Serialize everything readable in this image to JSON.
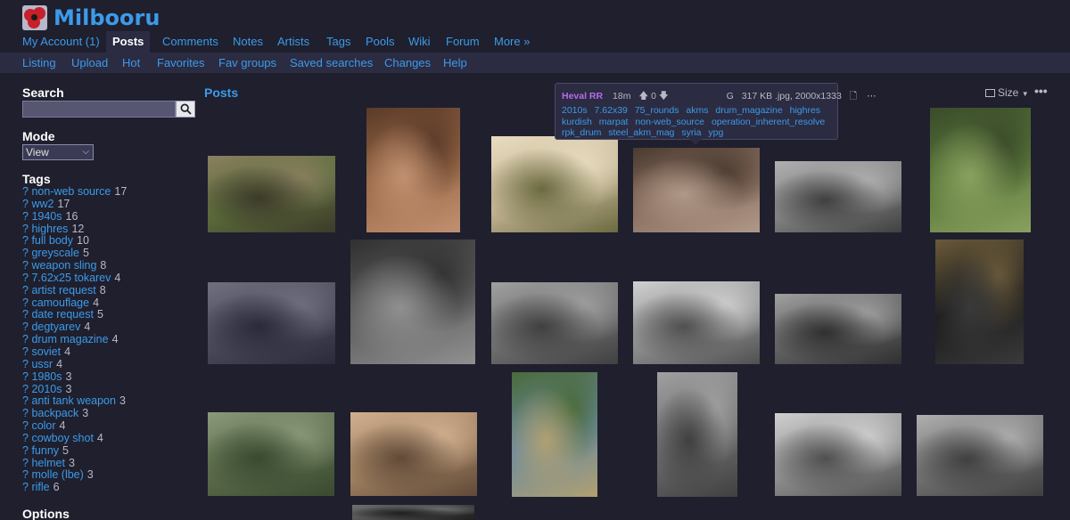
{
  "site": {
    "title": "Milbooru"
  },
  "nav": {
    "main": [
      "My Account (1)",
      "Posts",
      "Comments",
      "Notes",
      "Artists",
      "Tags",
      "Pools",
      "Wiki",
      "Forum",
      "More »"
    ],
    "sub": [
      "Listing",
      "Upload",
      "Hot",
      "Favorites",
      "Fav groups",
      "Saved searches",
      "Changes",
      "Help"
    ]
  },
  "sidebar": {
    "search_heading": "Search",
    "search_value": "",
    "mode_heading": "Mode",
    "mode_value": "View",
    "tags_heading": "Tags",
    "tags": [
      {
        "name": "non-web source",
        "count": "17"
      },
      {
        "name": "ww2",
        "count": "17"
      },
      {
        "name": "1940s",
        "count": "16"
      },
      {
        "name": "highres",
        "count": "12"
      },
      {
        "name": "full body",
        "count": "10"
      },
      {
        "name": "greyscale",
        "count": "5"
      },
      {
        "name": "weapon sling",
        "count": "8"
      },
      {
        "name": "7.62x25 tokarev",
        "count": "4"
      },
      {
        "name": "artist request",
        "count": "8"
      },
      {
        "name": "camouflage",
        "count": "4"
      },
      {
        "name": "date request",
        "count": "5"
      },
      {
        "name": "degtyarev",
        "count": "4"
      },
      {
        "name": "drum magazine",
        "count": "4"
      },
      {
        "name": "soviet",
        "count": "4"
      },
      {
        "name": "ussr",
        "count": "4"
      },
      {
        "name": "1980s",
        "count": "3"
      },
      {
        "name": "2010s",
        "count": "3"
      },
      {
        "name": "anti tank weapon",
        "count": "3"
      },
      {
        "name": "backpack",
        "count": "3"
      },
      {
        "name": "color",
        "count": "4"
      },
      {
        "name": "cowboy shot",
        "count": "4"
      },
      {
        "name": "funny",
        "count": "5"
      },
      {
        "name": "helmet",
        "count": "3"
      },
      {
        "name": "molle (lbe)",
        "count": "3"
      },
      {
        "name": "rifle",
        "count": "6"
      }
    ],
    "options_heading": "Options"
  },
  "posts": {
    "title": "Posts",
    "size_label": "Size",
    "more_label": "•••"
  },
  "tooltip": {
    "user": "Heval RR",
    "age": "18m",
    "score": "0",
    "rating": "G",
    "file_info": "317 KB .jpg, 2000x1333",
    "tags": [
      "2010s",
      "7.62x39",
      "75_rounds",
      "akms",
      "drum_magazine",
      "highres",
      "kurdish",
      "marpat",
      "non-web_source",
      "operation_inherent_resolve",
      "rpk_drum",
      "steel_akm_mag",
      "syria",
      "ypg"
    ]
  },
  "thumbnails": [
    {
      "name": "thumb-afghan-fighters",
      "colors": [
        "#5a6b3a",
        "#3d3a2a",
        "#8a8060"
      ]
    },
    {
      "name": "thumb-soldier-rpg",
      "colors": [
        "#9a6a48",
        "#c09070",
        "#5a3a28"
      ]
    },
    {
      "name": "thumb-soldier-firing-rpg",
      "colors": [
        "#c8b898",
        "#6a6a40",
        "#e8dcc0"
      ]
    },
    {
      "name": "thumb-kurdish-fighter",
      "colors": [
        "#8a7060",
        "#b09888",
        "#4a3a30"
      ]
    },
    {
      "name": "thumb-trench-soldiers",
      "colors": [
        "#808080",
        "#404040",
        "#b0b0b0"
      ]
    },
    {
      "name": "thumb-officers-park",
      "colors": [
        "#5a7a3a",
        "#8aa060",
        "#3a4a2a"
      ]
    },
    {
      "name": "thumb-spec-ops-team",
      "colors": [
        "#4a4a5a",
        "#2a2a3a",
        "#707080"
      ]
    },
    {
      "name": "thumb-german-soldiers",
      "colors": [
        "#606060",
        "#909090",
        "#303030"
      ]
    },
    {
      "name": "thumb-factory-woman",
      "colors": [
        "#707070",
        "#404040",
        "#a0a0a0"
      ]
    },
    {
      "name": "thumb-red-flag-soldiers",
      "colors": [
        "#909090",
        "#505050",
        "#d0d0d0"
      ]
    },
    {
      "name": "thumb-firing-line",
      "colors": [
        "#606060",
        "#303030",
        "#a0a0a0"
      ]
    },
    {
      "name": "thumb-poster-document",
      "colors": [
        "#1a1a1a",
        "#3a3a3a",
        "#6a5a3a"
      ]
    },
    {
      "name": "thumb-soldier-helmet",
      "colors": [
        "#5a6a4a",
        "#3a4a30",
        "#8a9a7a"
      ]
    },
    {
      "name": "thumb-desert-soldier",
      "colors": [
        "#a08060",
        "#604a38",
        "#d0b090"
      ]
    },
    {
      "name": "thumb-beach-carry",
      "colors": [
        "#6a8aa0",
        "#b0a070",
        "#4a6a3a"
      ]
    },
    {
      "name": "thumb-artillery-gun",
      "colors": [
        "#707070",
        "#404040",
        "#a0a0a0"
      ]
    },
    {
      "name": "thumb-children-cannon",
      "colors": [
        "#909090",
        "#505050",
        "#d0d0d0"
      ]
    },
    {
      "name": "thumb-soldier-bazooka",
      "colors": [
        "#707070",
        "#404040",
        "#b0b0b0"
      ]
    },
    {
      "name": "thumb-partial-bottom",
      "colors": [
        "#404040",
        "#202020",
        "#707070"
      ]
    }
  ]
}
